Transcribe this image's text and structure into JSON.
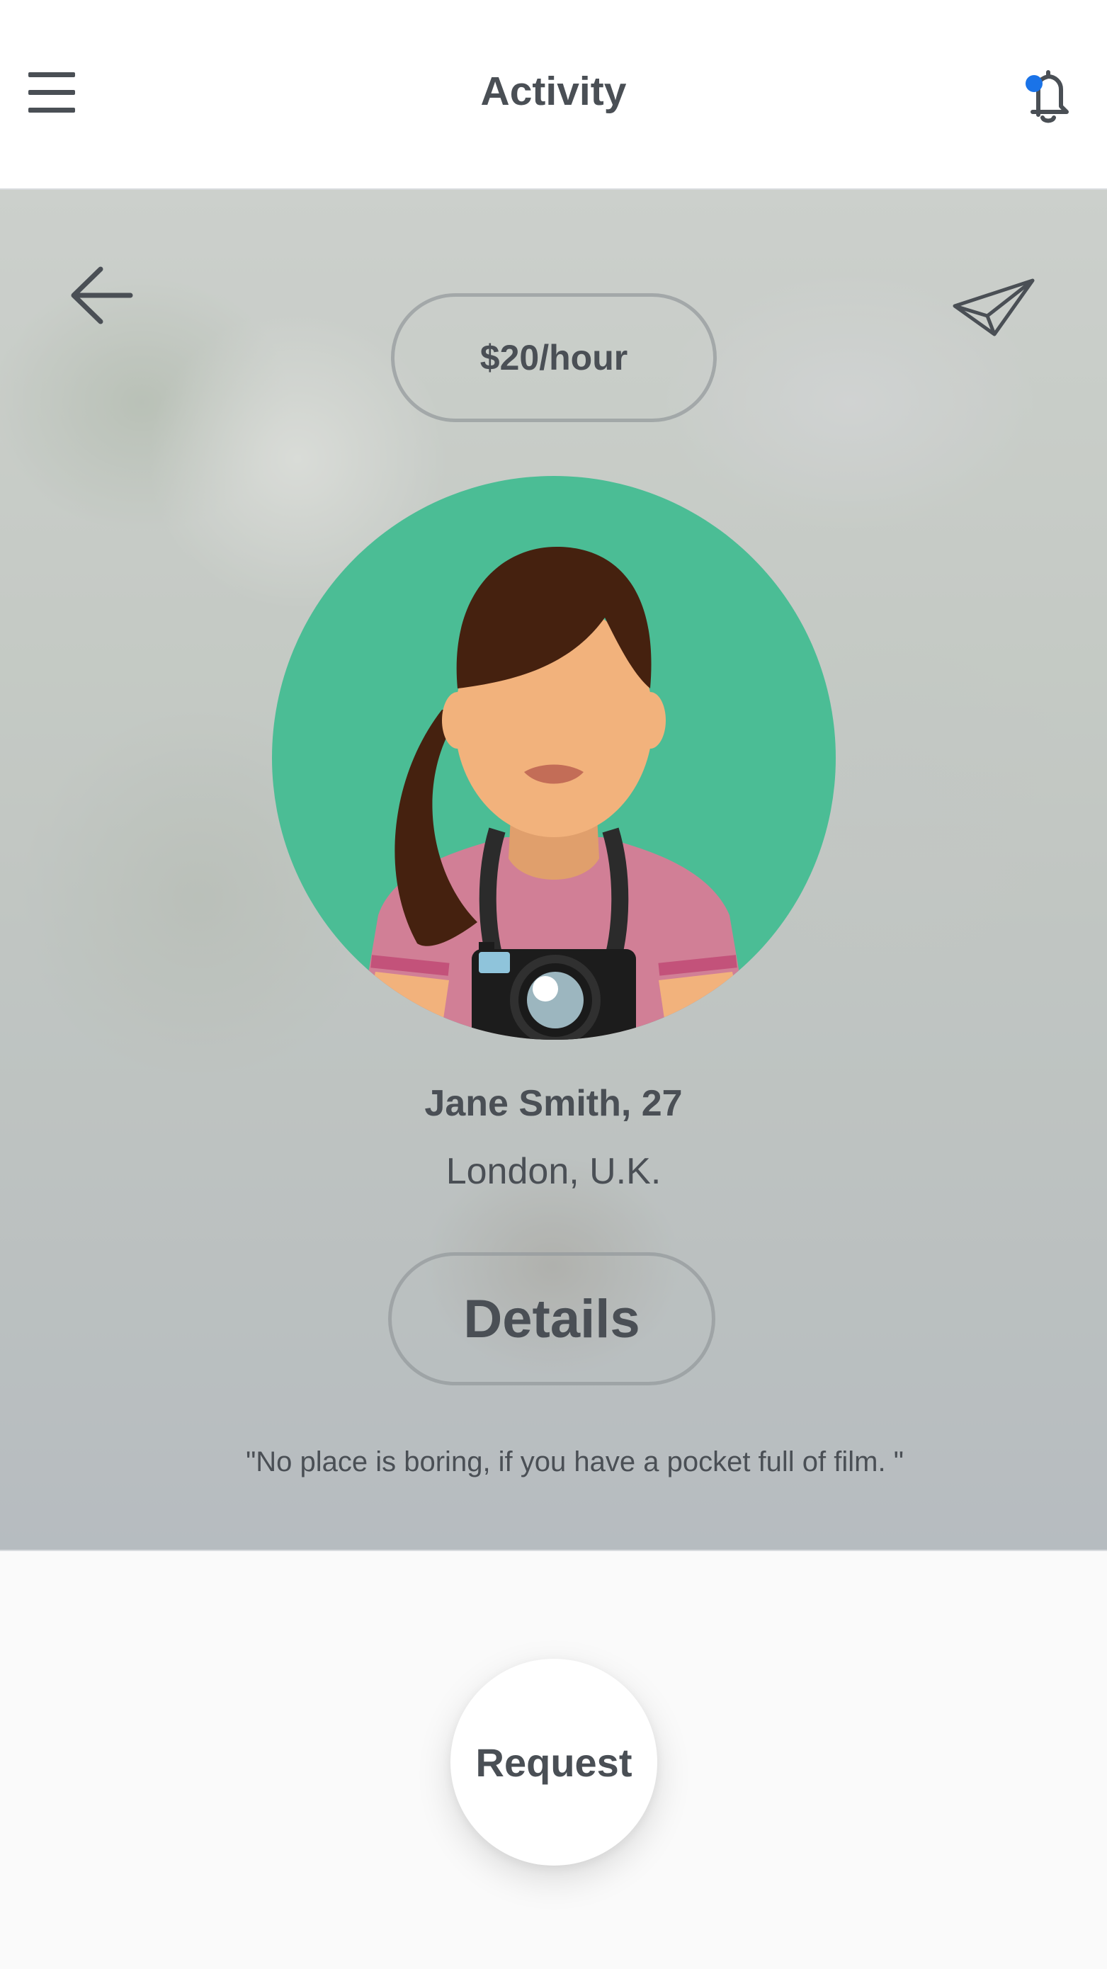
{
  "header": {
    "title": "Activity",
    "menu_icon": "hamburger-menu-icon",
    "notification_icon": "bell-icon",
    "notification_dot_color": "#1a73e8"
  },
  "hero": {
    "back_icon": "arrow-left-icon",
    "send_icon": "paper-plane-icon",
    "rate": "$20/hour",
    "avatar_colors": {
      "background": "#4bbd95",
      "hair": "#45210f",
      "skin": "#f2b27c",
      "shirt": "#d17f96",
      "camera": "#1c1c1c"
    },
    "name": "Jane Smith, 27",
    "location": "London, U.K.",
    "details_label": "Details",
    "quote": "\"No place is boring, if you have a pocket full of film. \""
  },
  "footer": {
    "request_label": "Request"
  }
}
